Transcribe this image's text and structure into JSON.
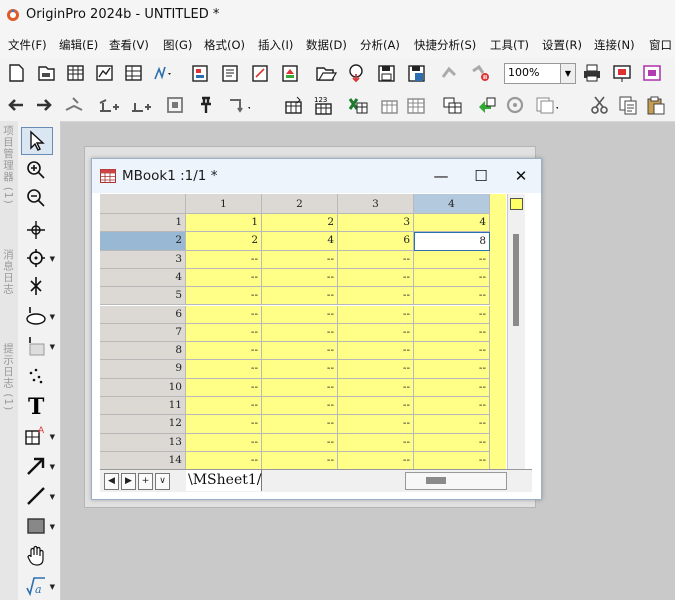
{
  "app": {
    "title": "OriginPro 2024b - UNTITLED *"
  },
  "menu": [
    "文件(F)",
    "编辑(E)",
    "查看(V)",
    "图(G)",
    "格式(O)",
    "插入(I)",
    "数据(D)",
    "分析(A)",
    "快捷分析(S)",
    "工具(T)",
    "设置(R)",
    "连接(N)",
    "窗口"
  ],
  "toolbar": {
    "zoom_value": "100%"
  },
  "left_panels": [
    "项目管理器 (1)",
    "消息日志",
    "提示日志 (1)"
  ],
  "tools": [
    "pointer-tool",
    "zoom-in-tool",
    "zoom-out-tool",
    "data-reader-tool",
    "screen-reader-tool",
    "data-selector-tool",
    "region-selector-tool",
    "mask-tool",
    "scatter-selector-tool",
    "text-tool",
    "annotation-tool",
    "arrow-tool",
    "line-tool",
    "rectangle-tool",
    "hand-tool",
    "equation-tool"
  ],
  "workbook": {
    "title": "MBook1 :1/1  *",
    "columns": [
      "1",
      "2",
      "3",
      "4"
    ],
    "selected_column": "4",
    "selected_row": "2",
    "rows": [
      {
        "label": "1",
        "values": [
          "1",
          "2",
          "3",
          "4"
        ]
      },
      {
        "label": "2",
        "values": [
          "2",
          "4",
          "6",
          "8"
        ]
      },
      {
        "label": "3",
        "values": [
          "--",
          "--",
          "--",
          "--"
        ]
      },
      {
        "label": "4",
        "values": [
          "--",
          "--",
          "--",
          "--"
        ]
      },
      {
        "label": "5",
        "values": [
          "--",
          "--",
          "--",
          "--"
        ]
      },
      {
        "label": "6",
        "values": [
          "--",
          "--",
          "--",
          "--"
        ]
      },
      {
        "label": "7",
        "values": [
          "--",
          "--",
          "--",
          "--"
        ]
      },
      {
        "label": "8",
        "values": [
          "--",
          "--",
          "--",
          "--"
        ]
      },
      {
        "label": "9",
        "values": [
          "--",
          "--",
          "--",
          "--"
        ]
      },
      {
        "label": "10",
        "values": [
          "--",
          "--",
          "--",
          "--"
        ]
      },
      {
        "label": "11",
        "values": [
          "--",
          "--",
          "--",
          "--"
        ]
      },
      {
        "label": "12",
        "values": [
          "--",
          "--",
          "--",
          "--"
        ]
      },
      {
        "label": "13",
        "values": [
          "--",
          "--",
          "--",
          "--"
        ]
      },
      {
        "label": "14",
        "values": [
          "--",
          "--",
          "--",
          "--"
        ]
      }
    ],
    "sheet_tab": "MSheet1"
  },
  "colors": {
    "data_cell": "#ffff88",
    "selected_header": "#b3c9de",
    "active_border": "#2a6fb0"
  }
}
